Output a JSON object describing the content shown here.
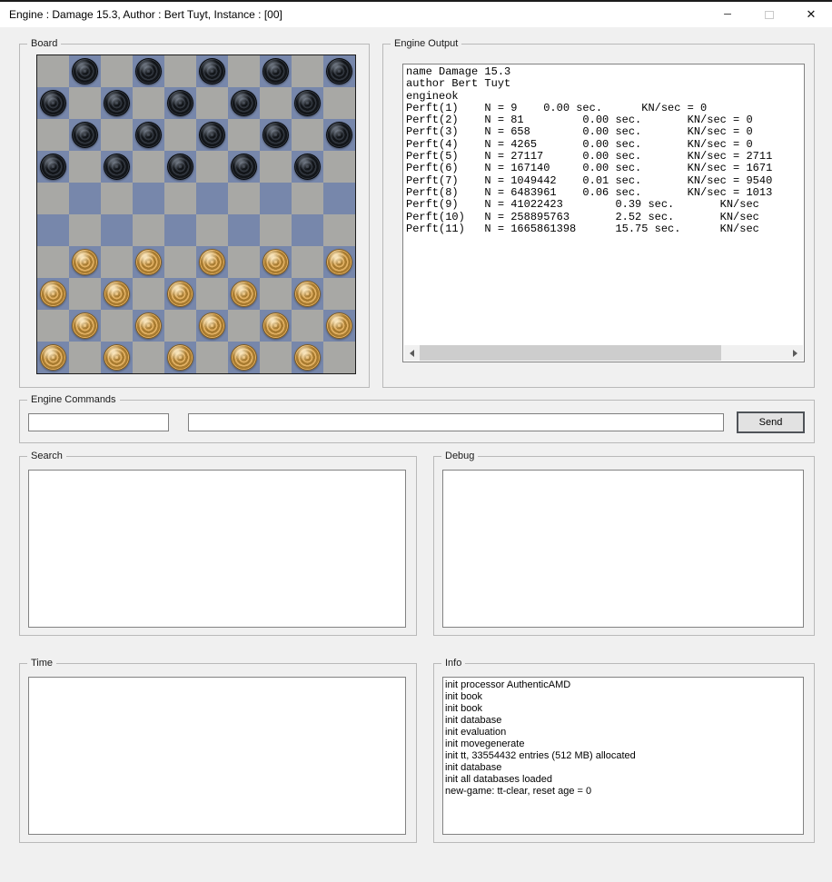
{
  "window": {
    "title": "Engine : Damage 15.3, Author : Bert Tuyt, Instance : [00]",
    "controls": {
      "minimize_glyph": "─",
      "close_glyph": "✕"
    }
  },
  "groups": {
    "board_label": "Board",
    "engine_output_label": "Engine Output",
    "engine_commands_label": "Engine Commands",
    "search_label": "Search",
    "debug_label": "Debug",
    "time_label": "Time",
    "info_label": "Info"
  },
  "board": {
    "colors": {
      "light_square": "#a8a8a5",
      "dark_square": "#7787ab",
      "black_piece": "#14171b",
      "white_piece": "#d3a256"
    },
    "rows": [
      ".b.b.b.b.b",
      "b.b.b.b.b.",
      ".b.b.b.b.b",
      "b.b.b.b.b.",
      "..........",
      "..........",
      ".w.w.w.w.w",
      "w.w.w.w.w.",
      ".w.w.w.w.w",
      "w.w.w.w.w."
    ]
  },
  "engine_output": {
    "lines": [
      "name Damage 15.3",
      "author Bert Tuyt",
      "engineok",
      "Perft(1)    N = 9    0.00 sec.      KN/sec = 0",
      "Perft(2)    N = 81         0.00 sec.       KN/sec = 0",
      "Perft(3)    N = 658        0.00 sec.       KN/sec = 0",
      "Perft(4)    N = 4265       0.00 sec.       KN/sec = 0",
      "Perft(5)    N = 27117      0.00 sec.       KN/sec = 2711",
      "Perft(6)    N = 167140     0.00 sec.       KN/sec = 1671",
      "Perft(7)    N = 1049442    0.01 sec.       KN/sec = 9540",
      "Perft(8)    N = 6483961    0.06 sec.       KN/sec = 1013",
      "Perft(9)    N = 41022423        0.39 sec.       KN/sec",
      "Perft(10)   N = 258895763       2.52 sec.       KN/sec",
      "Perft(11)   N = 1665861398      15.75 sec.      KN/sec"
    ]
  },
  "engine_commands": {
    "command_value_small": "",
    "command_value_large": "",
    "send_label": "Send"
  },
  "search": {
    "content": ""
  },
  "debug": {
    "content": ""
  },
  "time": {
    "content": ""
  },
  "info": {
    "lines": [
      "init processor AuthenticAMD",
      "init book",
      "init book",
      "init database",
      "init evaluation",
      "init movegenerate",
      "init tt, 33554432 entries (512 MB) allocated",
      "init database",
      "init all databases loaded",
      "new-game: tt-clear, reset age = 0"
    ]
  }
}
